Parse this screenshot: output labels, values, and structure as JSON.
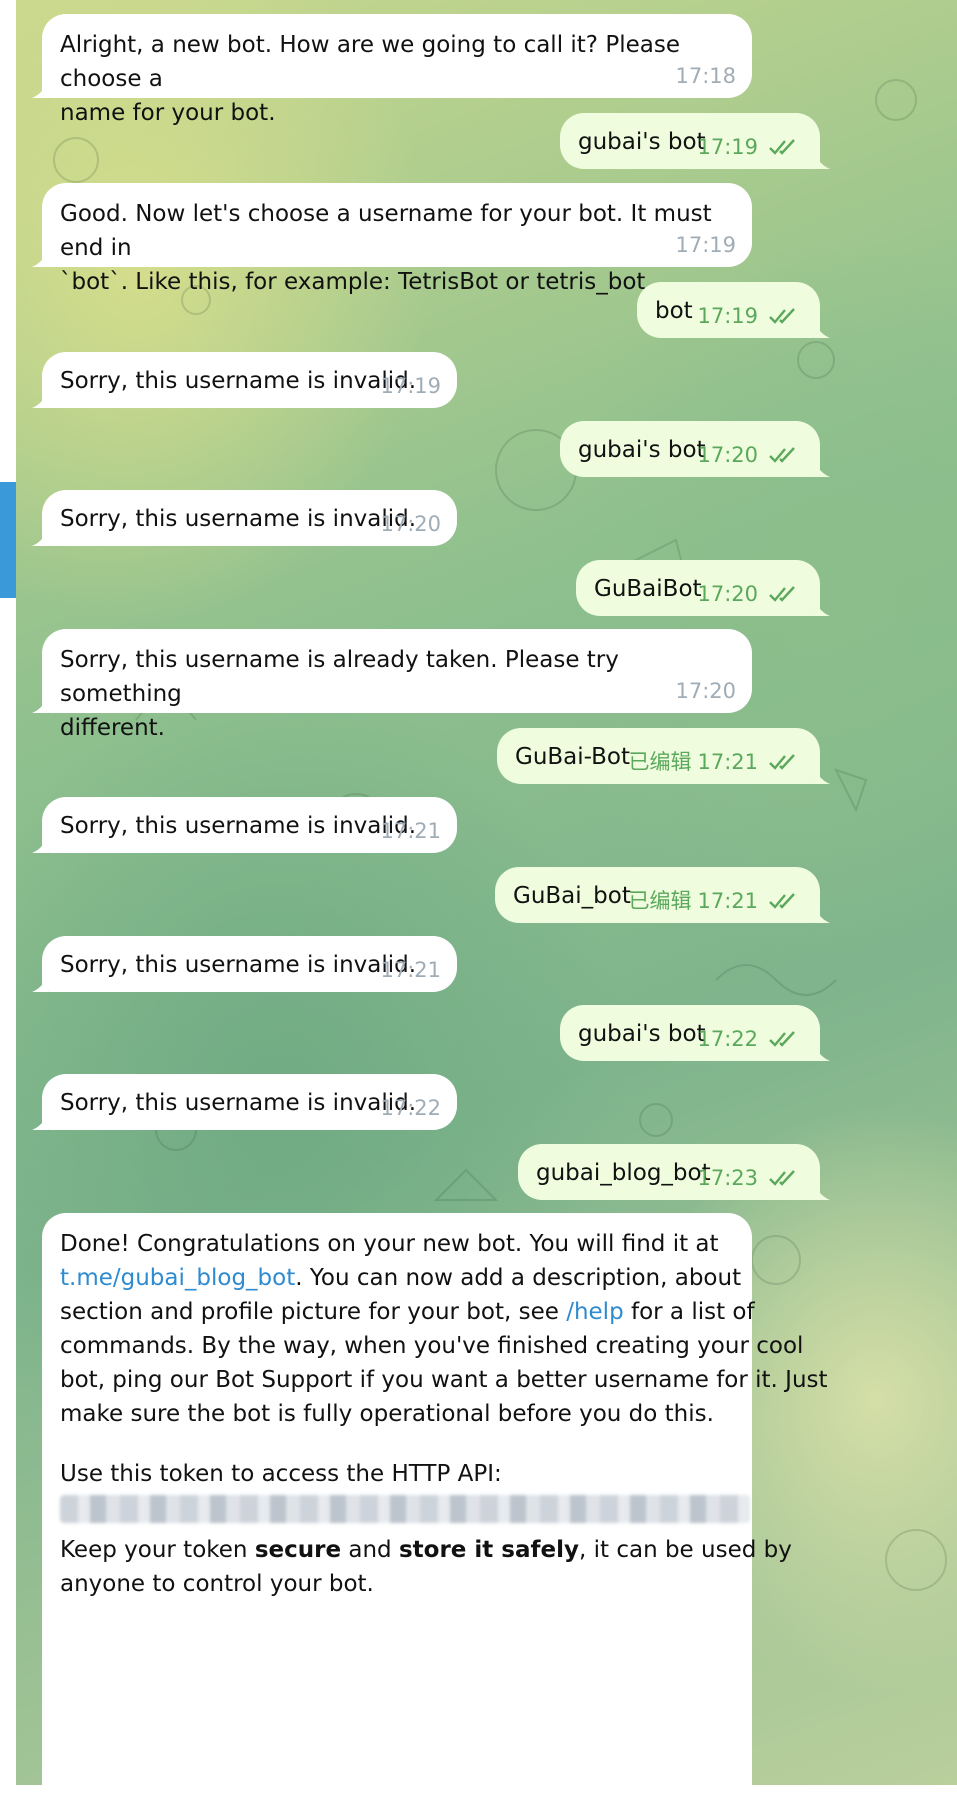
{
  "messages": [
    {
      "dir": "in",
      "text": "Alright, a new bot. How are we going to call it? Please choose a\nname for your bot.",
      "time": "17:18"
    },
    {
      "dir": "out",
      "text": "gubai's bot",
      "time": "17:19"
    },
    {
      "dir": "in",
      "text": "Good. Now let's choose a username for your bot. It must end in\n`bot`. Like this, for example: TetrisBot or tetris_bot.",
      "time": "17:19"
    },
    {
      "dir": "out",
      "text": "bot",
      "time": "17:19"
    },
    {
      "dir": "in",
      "text": "Sorry, this username is invalid.",
      "time": "17:19"
    },
    {
      "dir": "out",
      "text": "gubai's bot",
      "time": "17:20"
    },
    {
      "dir": "in",
      "text": "Sorry, this username is invalid.",
      "time": "17:20"
    },
    {
      "dir": "out",
      "text": "GuBaiBot",
      "time": "17:20"
    },
    {
      "dir": "in",
      "text": "Sorry, this username is already taken. Please try something\ndifferent.",
      "time": "17:20"
    },
    {
      "dir": "out",
      "text": "GuBai-Bot",
      "time": "17:21",
      "edited": "已编辑"
    },
    {
      "dir": "in",
      "text": "Sorry, this username is invalid.",
      "time": "17:21"
    },
    {
      "dir": "out",
      "text": "GuBai_bot",
      "time": "17:21",
      "edited": "已编辑"
    },
    {
      "dir": "in",
      "text": "Sorry, this username is invalid.",
      "time": "17:21"
    },
    {
      "dir": "out",
      "text": "gubai's bot",
      "time": "17:22"
    },
    {
      "dir": "in",
      "text": "Sorry, this username is invalid.",
      "time": "17:22"
    },
    {
      "dir": "out",
      "text": "gubai_blog_bot",
      "time": "17:23"
    }
  ],
  "final_message": {
    "p1_a": "Done! Congratulations on your new bot. You will find it at",
    "link_tme": "t.me/gubai_blog_bot",
    "p1_b": ". You can now add a description, about",
    "p1_c": "section and profile picture for your bot, see ",
    "link_help": "/help",
    "p1_d": " for a list of",
    "p1_e": "commands. By the way, when you've finished creating your cool",
    "p1_f": "bot, ping our Bot Support if you want a better username for it. Just",
    "p1_g": "make sure the bot is fully operational before you do this.",
    "p2": "Use this token to access the HTTP API:",
    "p3_a": "Keep your token ",
    "p3_b": "secure",
    "p3_c": " and ",
    "p3_d": "store it safely",
    "p3_e": ", it can be used by",
    "p3_f": "anyone to control your bot."
  },
  "colors": {
    "incoming": "#ffffff",
    "outgoing": "#effdde",
    "link": "#2f8bd0",
    "time_in": "#a0acb6",
    "time_out": "#5ba85c",
    "accent": "#3a9ad9"
  }
}
